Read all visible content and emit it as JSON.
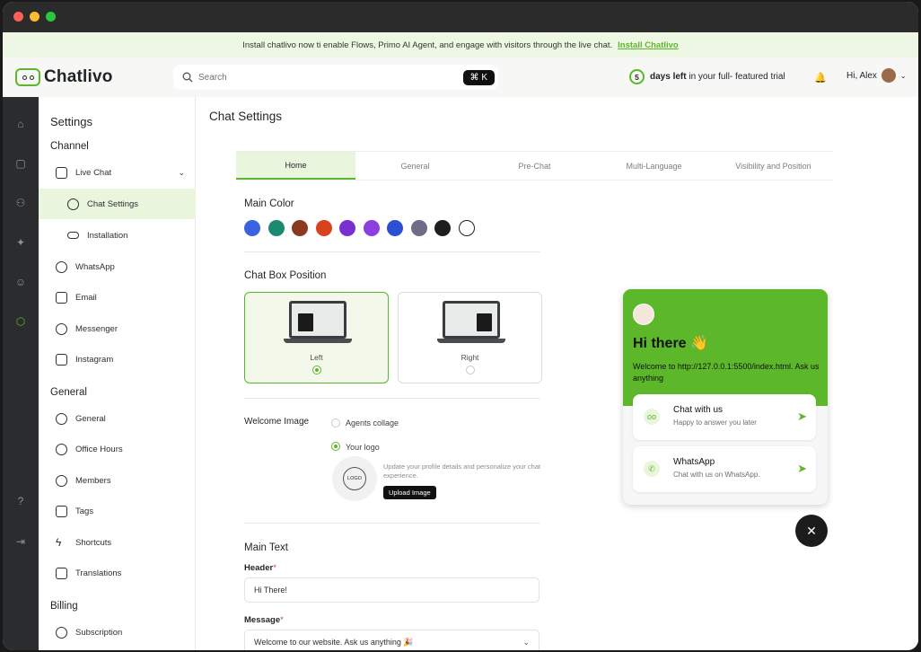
{
  "banner": {
    "text": "Install chatlivo now ti enable Flows, Primo AI Agent, and engage with visitors through the live chat.",
    "link": "Install Chatlivo"
  },
  "brand": {
    "name": "Chatlivo",
    "accent": "#5cb82a"
  },
  "search": {
    "placeholder": "Search",
    "shortcut": "⌘ K"
  },
  "trial": {
    "days": "5",
    "text_bold": "days left",
    "text_rest": " in your full- featured trial"
  },
  "user": {
    "greeting": "Hi, Alex"
  },
  "rail": {
    "icons": [
      "home-icon",
      "chat-icon",
      "contacts-icon",
      "magic-icon",
      "bot-icon",
      "settings-icon",
      "help-icon",
      "logout-icon"
    ]
  },
  "sidebar": {
    "title": "Settings",
    "channel_label": "Channel",
    "live_chat": "Live Chat",
    "chat_settings": "Chat Settings",
    "installation": "Installation",
    "whatsapp": "WhatsApp",
    "email": "Email",
    "messenger": "Messenger",
    "instagram": "Instagram",
    "general_label": "General",
    "general": "General",
    "office_hours": "Office Hours",
    "members": "Members",
    "tags": "Tags",
    "shortcuts": "Shortcuts",
    "translations": "Translations",
    "billing_label": "Billing",
    "subscription": "Subscription"
  },
  "main": {
    "title": "Chat Settings",
    "tabs": [
      "Home",
      "General",
      "Pre-Chat",
      "Multi-Language",
      "Visibility and Position"
    ],
    "main_color_label": "Main Color",
    "colors": [
      "#3b63e0",
      "#1a8a72",
      "#8a3a1e",
      "#d8431e",
      "#7a2fd0",
      "#8d3ee0",
      "#2d4fd1",
      "#6e6c86",
      "#1e1e20",
      "#ffffff"
    ],
    "position_label": "Chat Box Position",
    "pos_left": "Left",
    "pos_right": "Right",
    "welcome_image_label": "Welcome Image",
    "opt_agents": "Agents collage",
    "opt_logo": "Your logo",
    "logo_placeholder": "LOGO",
    "upload_hint": "Update your profile details and personalize your chat experience.",
    "upload_btn": "Upload Image",
    "main_text_label": "Main Text",
    "header_label": "Header",
    "header_value": "Hi There!",
    "message_label": "Message",
    "message_value": "Welcome to our website. Ask us anything 🎉",
    "required": "*"
  },
  "widget": {
    "greeting": "Hi there 👋",
    "welcome": "Welcome to http://127.0.0.1:5500/index.html. Ask us anything",
    "card1_title": "Chat with us",
    "card1_sub": "Happy to answer you later",
    "card2_title": "WhatsApp",
    "card2_sub": "Chat with us on WhatsApp."
  }
}
